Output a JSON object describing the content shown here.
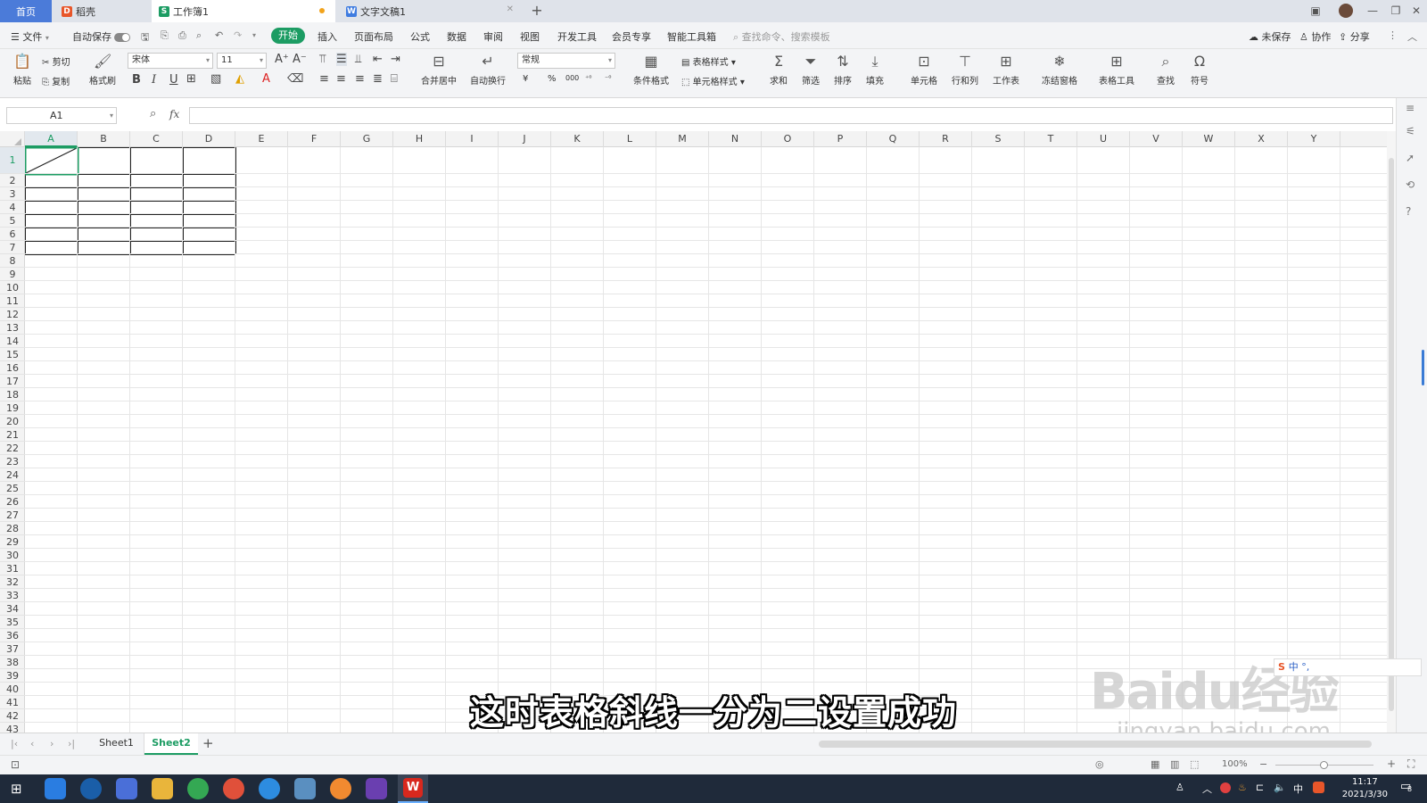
{
  "tabs": {
    "home": "首页",
    "daoke": "稻壳",
    "workbook": "工作簿1",
    "document": "文字文稿1"
  },
  "menu": {
    "file": "文件",
    "autosave": "自动保存",
    "start": "开始",
    "insert": "插入",
    "page_layout": "页面布局",
    "formula": "公式",
    "data": "数据",
    "review": "审阅",
    "view": "视图",
    "dev_tools": "开发工具",
    "member": "会员专享",
    "smart_tools": "智能工具箱",
    "search_placeholder": "查找命令、搜索模板",
    "unsaved": "未保存",
    "collaborate": "协作",
    "share": "分享"
  },
  "ribbon": {
    "paste": "粘贴",
    "cut": "剪切",
    "copy": "复制",
    "format_painter": "格式刷",
    "font_name": "宋体",
    "font_size": "11",
    "merge_center": "合并居中",
    "wrap_text": "自动换行",
    "number_format": "常规",
    "table_style": "表格样式",
    "conditional_format": "条件格式",
    "cell_style": "单元格样式",
    "sum": "求和",
    "filter": "筛选",
    "sort": "排序",
    "fill": "填充",
    "cell": "单元格",
    "row_col": "行和列",
    "worksheet": "工作表",
    "freeze": "冻结窗格",
    "table_tools": "表格工具",
    "find": "查找",
    "symbol": "符号",
    "bold": "B",
    "italic": "I",
    "underline": "U",
    "currency": "¥",
    "percent": "%",
    "thousands": "000"
  },
  "formula_bar": {
    "cell_ref": "A1",
    "fx": "fx"
  },
  "columns": [
    "A",
    "B",
    "C",
    "D",
    "E",
    "F",
    "G",
    "H",
    "I",
    "J",
    "K",
    "L",
    "M",
    "N",
    "O",
    "P",
    "Q",
    "R",
    "S",
    "T",
    "U",
    "V",
    "W",
    "X",
    "Y"
  ],
  "rows": [
    "1",
    "2",
    "3",
    "4",
    "5",
    "6",
    "7",
    "8",
    "9",
    "10",
    "11",
    "12",
    "13",
    "14",
    "15",
    "16",
    "17",
    "18",
    "19",
    "20",
    "21",
    "22",
    "23",
    "24",
    "25",
    "26",
    "27",
    "28",
    "29",
    "30",
    "31",
    "32",
    "33",
    "34",
    "35",
    "36",
    "37",
    "38",
    "39",
    "40",
    "41",
    "42",
    "43"
  ],
  "sheets": {
    "sheet1": "Sheet1",
    "sheet2": "Sheet2",
    "add": "+"
  },
  "status": {
    "zoom": "100%"
  },
  "subtitle": "这时表格斜线一分为二设置成功",
  "watermark": {
    "logo": "Baidu经验",
    "url": "jingyan.baidu.com"
  },
  "ime": "中 °,",
  "taskbar": {
    "time": "11:17",
    "date": "2021/3/30",
    "ime_lang": "中",
    "notification_count": "8"
  },
  "colors": {
    "accent": "#1c9c63",
    "home_tab": "#4b7bd9",
    "taskbar": "#1f2a3a"
  }
}
